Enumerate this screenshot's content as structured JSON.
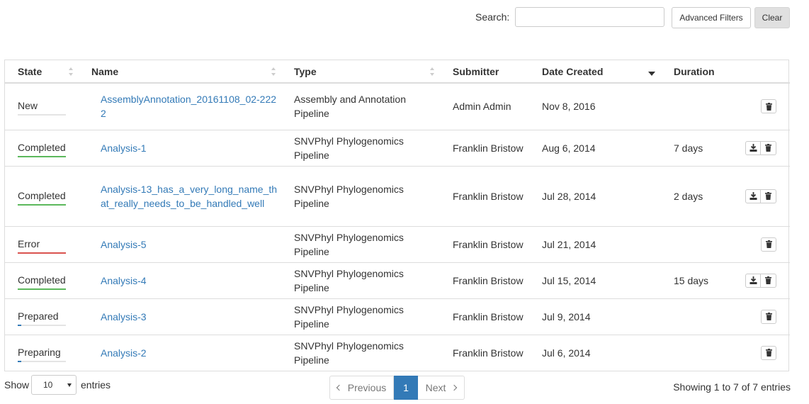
{
  "search": {
    "label": "Search:",
    "placeholder": "",
    "value": ""
  },
  "toolbar": {
    "advanced_filters_label": "Advanced Filters",
    "clear_label": "Clear"
  },
  "table": {
    "columns": [
      {
        "label": "State",
        "sort": "both"
      },
      {
        "label": "Name",
        "sort": "both"
      },
      {
        "label": "Type",
        "sort": "both"
      },
      {
        "label": "Submitter",
        "sort": "none"
      },
      {
        "label": "Date Created",
        "sort": "desc"
      },
      {
        "label": "Duration",
        "sort": "none"
      }
    ],
    "rows": [
      {
        "state": "New",
        "progress": 0,
        "state_color": "#bbbbbb",
        "name": "AssemblyAnnotation_20161108_02-2222",
        "type": "Assembly and Annotation Pipeline",
        "submitter": "Admin Admin",
        "date": "Nov 8, 2016",
        "duration": "",
        "download": false
      },
      {
        "state": "Completed",
        "progress": 1.0,
        "state_color": "#5cb85c",
        "name": "Analysis-1",
        "type": "SNVPhyl Phylogenomics Pipeline",
        "submitter": "Franklin Bristow",
        "date": "Aug 6, 2014",
        "duration": "7 days",
        "download": true
      },
      {
        "state": "Completed",
        "progress": 1.0,
        "state_color": "#5cb85c",
        "name": "Analysis-13_has_a_very_long_name_that_really_needs_to_be_handled_well",
        "type": "SNVPhyl Phylogenomics Pipeline",
        "submitter": "Franklin Bristow",
        "date": "Jul 28, 2014",
        "duration": "2 days",
        "download": true
      },
      {
        "state": "Error",
        "progress": 1.0,
        "state_color": "#d9534f",
        "name": "Analysis-5",
        "type": "SNVPhyl Phylogenomics Pipeline",
        "submitter": "Franklin Bristow",
        "date": "Jul 21, 2014",
        "duration": "",
        "download": false
      },
      {
        "state": "Completed",
        "progress": 1.0,
        "state_color": "#5cb85c",
        "name": "Analysis-4",
        "type": "SNVPhyl Phylogenomics Pipeline",
        "submitter": "Franklin Bristow",
        "date": "Jul 15, 2014",
        "duration": "15 days",
        "download": true
      },
      {
        "state": "Prepared",
        "progress": 0.08,
        "state_color": "#337ab7",
        "name": "Analysis-3",
        "type": "SNVPhyl Phylogenomics Pipeline",
        "submitter": "Franklin Bristow",
        "date": "Jul 9, 2014",
        "duration": "",
        "download": false
      },
      {
        "state": "Preparing",
        "progress": 0.08,
        "state_color": "#337ab7",
        "name": "Analysis-2",
        "type": "SNVPhyl Phylogenomics Pipeline",
        "submitter": "Franklin Bristow",
        "date": "Jul 6, 2014",
        "duration": "",
        "download": false
      }
    ]
  },
  "footer": {
    "show_label": "Show",
    "page_length": "10",
    "entries_label": "entries",
    "prev_label": "Previous",
    "current_page": "1",
    "next_label": "Next",
    "info": "Showing 1 to 7 of 7 entries"
  },
  "colors": {
    "link": "#337ab7",
    "accent": "#337ab7"
  },
  "icons": {
    "download": "download-icon",
    "delete": "trash-icon"
  }
}
